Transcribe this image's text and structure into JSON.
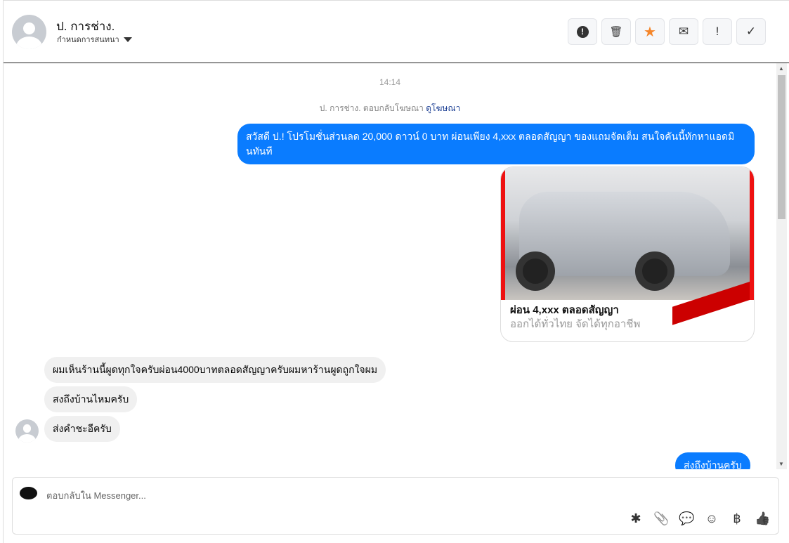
{
  "header": {
    "name": "ป. การช่าง.",
    "assign_label": "กำหนดการสนทนา",
    "actions": [
      {
        "icon": "alert-circle-icon",
        "glyph": "!"
      },
      {
        "icon": "trash-icon",
        "glyph": "🗑"
      },
      {
        "icon": "star-icon",
        "glyph": "★"
      },
      {
        "icon": "envelope-icon",
        "glyph": "✉"
      },
      {
        "icon": "exclamation-icon",
        "glyph": "!"
      },
      {
        "icon": "check-icon",
        "glyph": "✓"
      }
    ]
  },
  "chat": {
    "timestamp": "14:14",
    "ad_note": "ป. การช่าง. ตอบกลับโฆษณา",
    "ad_link": "ดูโฆษณา",
    "outgoing_1": "สวัสดี ป.! โปรโมชั่นส่วนลด 20,000 ดาวน์ 0 บาท ผ่อนเพียง 4,xxx ตลอดสัญญา ของแถมจัดเต็ม สนใจคันนี้ทักหาแอดมินทันที",
    "card": {
      "title": "ผ่อน 4,xxx ตลอดสัญญา",
      "subtitle": "ออกได้ทั่วไทย จัดได้ทุกอาชีพ"
    },
    "incoming": [
      "ผมเห็นร้านนี้ผูดทุกใจครับผ่อน4000บาทตลอดสัญญาครับผมหาร้านผูดถูกใจผม",
      "สงถึงบ้านไหมครับ",
      "ส่งคำชะอีครับ"
    ],
    "outgoing_2": "ส่งถึงบ้านครับ"
  },
  "composer": {
    "placeholder": "ตอบกลับใน Messenger...",
    "tools": [
      {
        "icon": "saved-reply-icon",
        "glyph": "✱"
      },
      {
        "icon": "paperclip-icon",
        "glyph": "📎"
      },
      {
        "icon": "chat-dots-icon",
        "glyph": "💬"
      },
      {
        "icon": "emoji-icon",
        "glyph": "☺"
      },
      {
        "icon": "baht-icon",
        "glyph": "฿"
      },
      {
        "icon": "thumbs-up-icon",
        "glyph": "👍"
      }
    ]
  },
  "colors": {
    "accent": "#0a7cff",
    "star": "#f5862a"
  }
}
